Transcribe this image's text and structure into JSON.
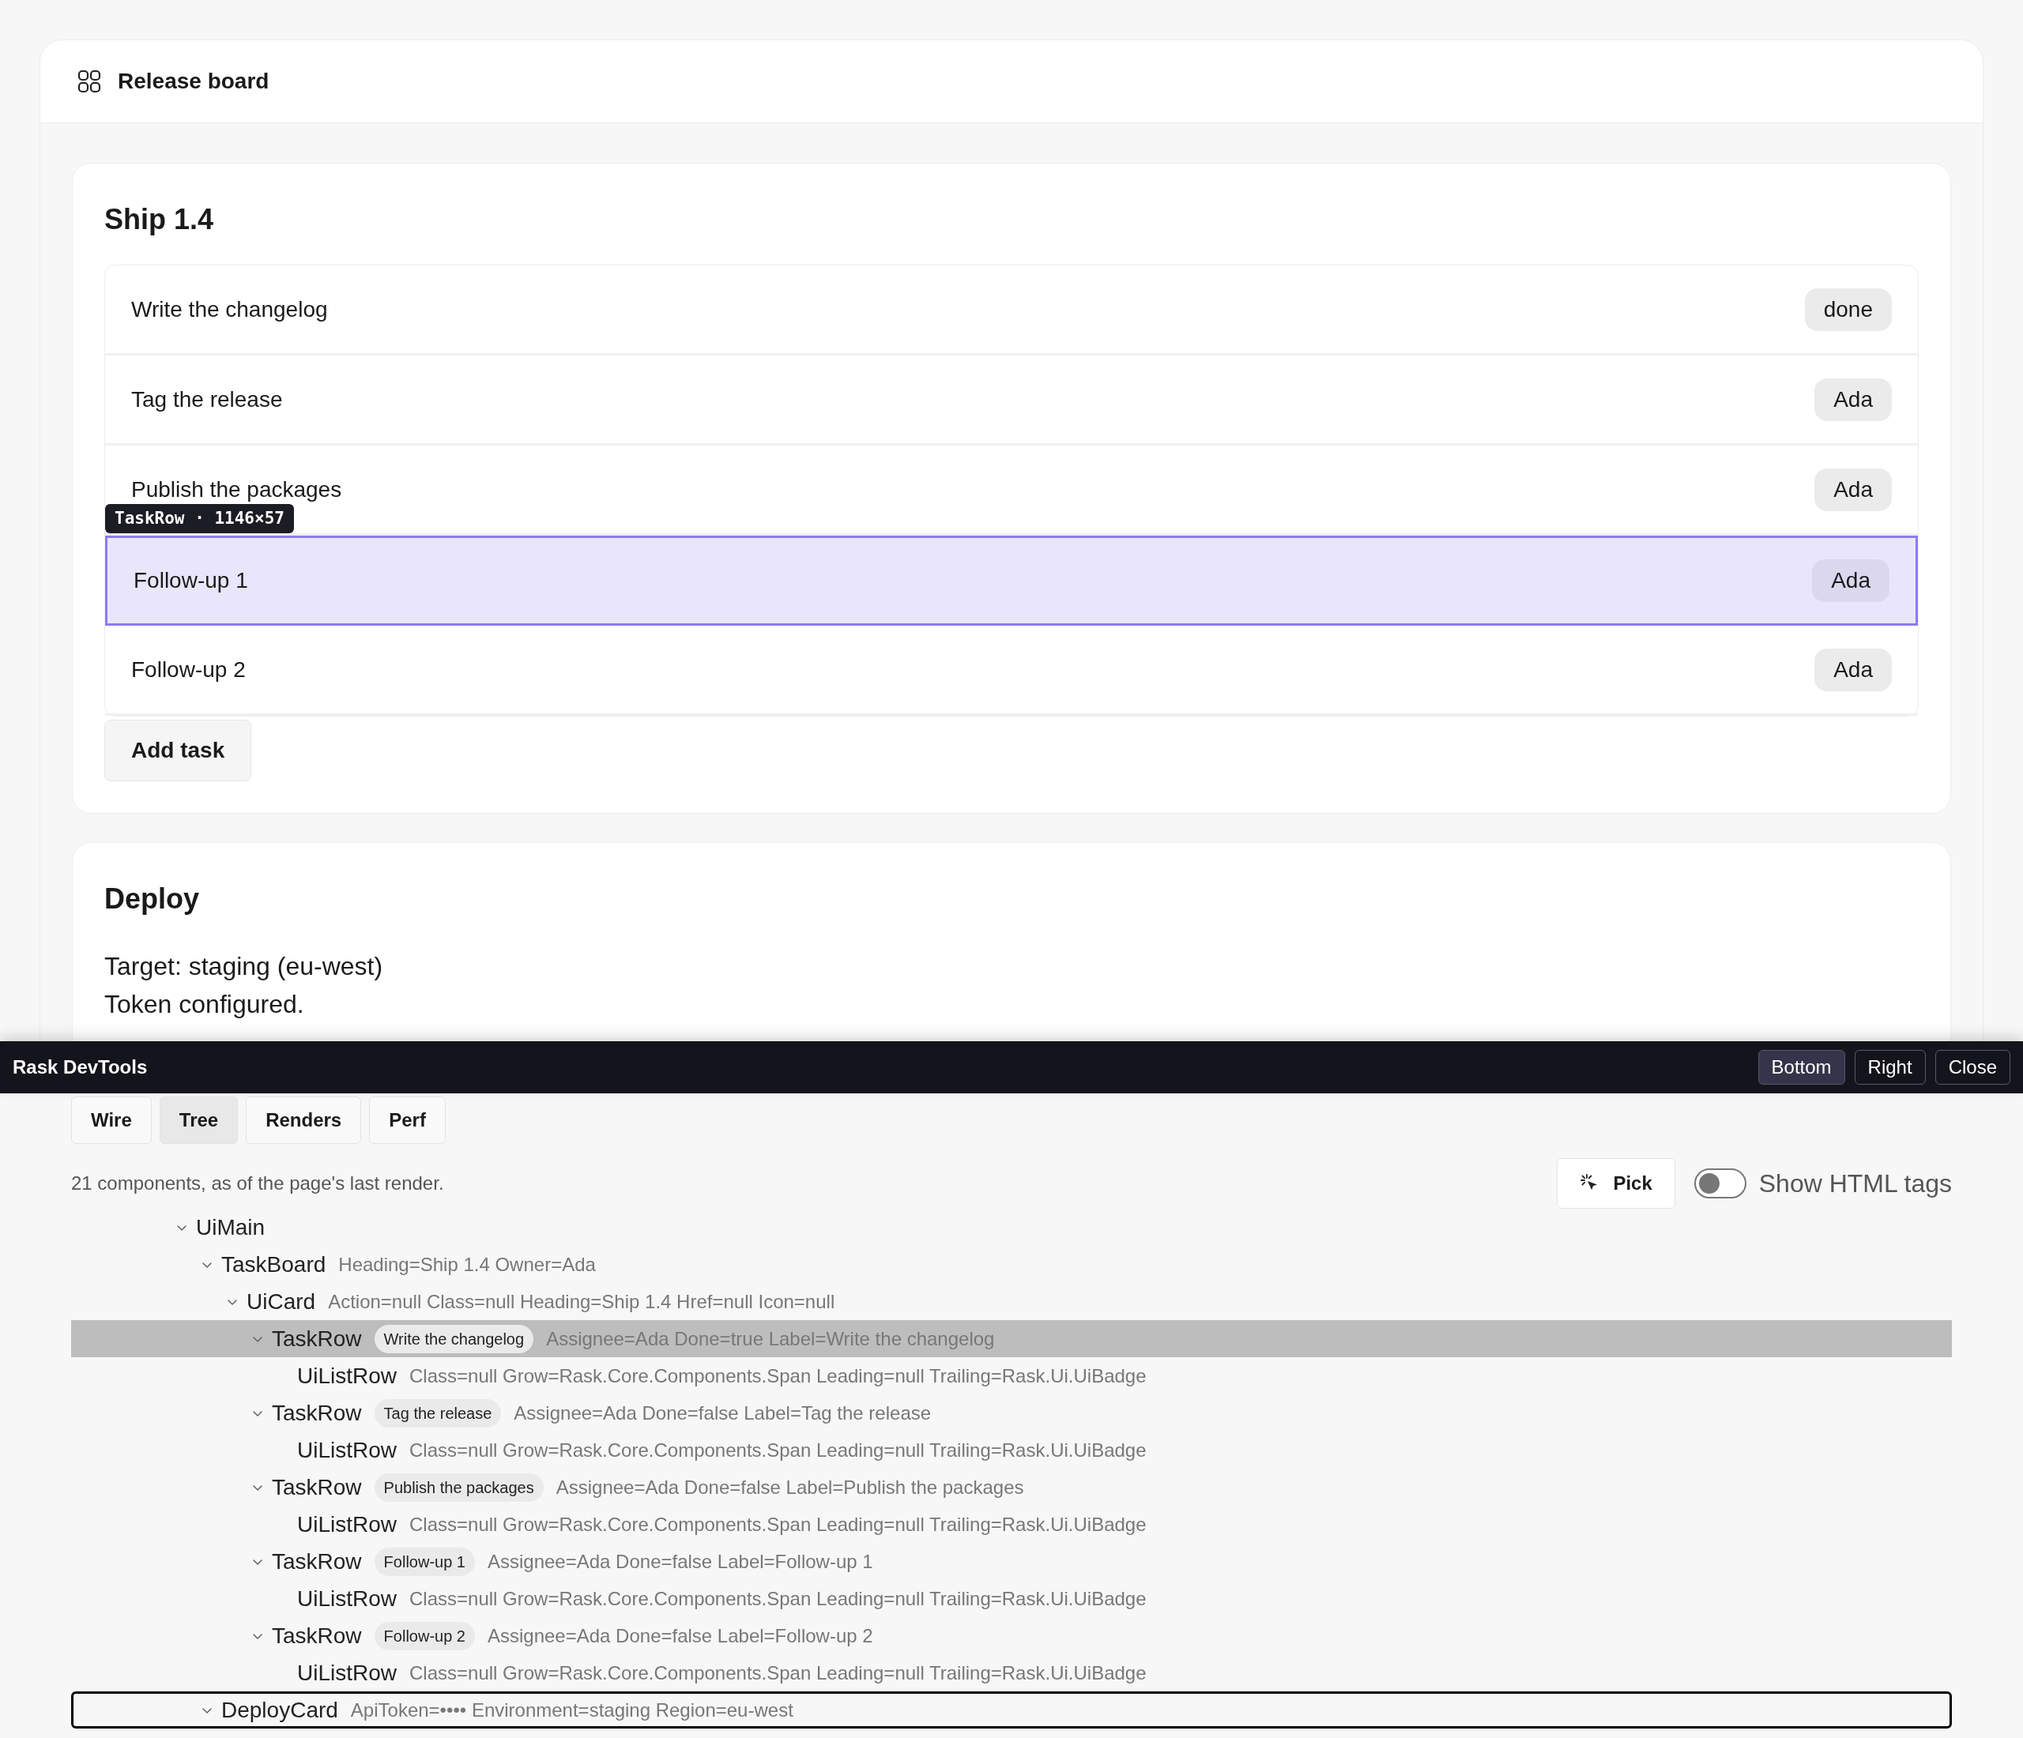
{
  "app": {
    "title": "Release board"
  },
  "cards": [
    {
      "kind": "tasks",
      "heading": "Ship 1.4",
      "rows": [
        {
          "label": "Write the changelog",
          "badge": "done",
          "highlighted": false
        },
        {
          "label": "Tag the release",
          "badge": "Ada",
          "highlighted": false
        },
        {
          "label": "Publish the packages",
          "badge": "Ada",
          "highlighted": false
        },
        {
          "label": "Follow-up 1",
          "badge": "Ada",
          "highlighted": true
        },
        {
          "label": "Follow-up 2",
          "badge": "Ada",
          "highlighted": false
        }
      ],
      "add_button": "Add task"
    },
    {
      "kind": "deploy",
      "heading": "Deploy",
      "lines": [
        "Target: staging (eu-west)",
        "Token configured."
      ]
    }
  ],
  "inspector_tooltip": "TaskRow · 1146×57",
  "devtools": {
    "title": "Rask DevTools",
    "dock_buttons": [
      {
        "label": "Bottom",
        "selected": true
      },
      {
        "label": "Right",
        "selected": false
      },
      {
        "label": "Close",
        "selected": false
      }
    ],
    "tabs": [
      {
        "label": "Wire",
        "selected": false
      },
      {
        "label": "Tree",
        "selected": true
      },
      {
        "label": "Renders",
        "selected": false
      },
      {
        "label": "Perf",
        "selected": false
      }
    ],
    "summary": "21 components, as of the page's last render.",
    "pick_button": "Pick",
    "html_tags_toggle": {
      "label": "Show HTML tags",
      "on": false
    },
    "tree": [
      {
        "name": "UiMain",
        "expanded": true,
        "selected": false,
        "focused": false,
        "children": [
          {
            "name": "TaskBoard",
            "props": "Heading=Ship 1.4 Owner=Ada",
            "expanded": true,
            "selected": false,
            "focused": false,
            "children": [
              {
                "name": "UiCard",
                "props": "Action=null Class=null Heading=Ship 1.4 Href=null Icon=null",
                "expanded": true,
                "selected": false,
                "focused": false,
                "children": [
                  {
                    "name": "TaskRow",
                    "pill": "Write the changelog",
                    "props": "Assignee=Ada Done=true Label=Write the changelog",
                    "expanded": true,
                    "selected": true,
                    "focused": false,
                    "children": [
                      {
                        "name": "UiListRow",
                        "props": "Class=null Grow=Rask.Core.Components.Span Leading=null Trailing=Rask.Ui.UiBadge",
                        "selected": false,
                        "focused": false
                      }
                    ]
                  },
                  {
                    "name": "TaskRow",
                    "pill": "Tag the release",
                    "props": "Assignee=Ada Done=false Label=Tag the release",
                    "expanded": true,
                    "selected": false,
                    "focused": false,
                    "children": [
                      {
                        "name": "UiListRow",
                        "props": "Class=null Grow=Rask.Core.Components.Span Leading=null Trailing=Rask.Ui.UiBadge",
                        "selected": false,
                        "focused": false
                      }
                    ]
                  },
                  {
                    "name": "TaskRow",
                    "pill": "Publish the packages",
                    "props": "Assignee=Ada Done=false Label=Publish the packages",
                    "expanded": true,
                    "selected": false,
                    "focused": false,
                    "children": [
                      {
                        "name": "UiListRow",
                        "props": "Class=null Grow=Rask.Core.Components.Span Leading=null Trailing=Rask.Ui.UiBadge",
                        "selected": false,
                        "focused": false
                      }
                    ]
                  },
                  {
                    "name": "TaskRow",
                    "pill": "Follow-up 1",
                    "props": "Assignee=Ada Done=false Label=Follow-up 1",
                    "expanded": true,
                    "selected": false,
                    "focused": false,
                    "children": [
                      {
                        "name": "UiListRow",
                        "props": "Class=null Grow=Rask.Core.Components.Span Leading=null Trailing=Rask.Ui.UiBadge",
                        "selected": false,
                        "focused": false
                      }
                    ]
                  },
                  {
                    "name": "TaskRow",
                    "pill": "Follow-up 2",
                    "props": "Assignee=Ada Done=false Label=Follow-up 2",
                    "expanded": true,
                    "selected": false,
                    "focused": false,
                    "children": [
                      {
                        "name": "UiListRow",
                        "props": "Class=null Grow=Rask.Core.Components.Span Leading=null Trailing=Rask.Ui.UiBadge",
                        "selected": false,
                        "focused": false
                      }
                    ]
                  }
                ]
              }
            ]
          },
          {
            "name": "DeployCard",
            "props": "ApiToken=•••• Environment=staging Region=eu-west",
            "expanded": true,
            "selected": false,
            "focused": true
          }
        ]
      }
    ]
  }
}
